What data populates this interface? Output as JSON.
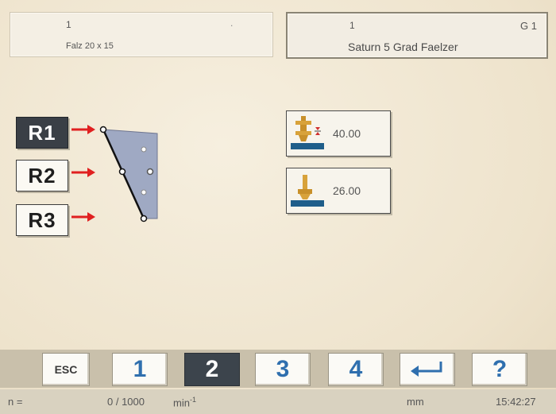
{
  "header": {
    "left": {
      "number": "1",
      "name": "Falz 20 x 15",
      "dot": "."
    },
    "right": {
      "number": "1",
      "group": "G 1",
      "name": "Saturn 5 Grad Faelzer"
    }
  },
  "rows": [
    {
      "label": "R1",
      "active": true
    },
    {
      "label": "R2",
      "active": false
    },
    {
      "label": "R3",
      "active": false
    }
  ],
  "values": [
    {
      "icon": "spindle-height-icon",
      "value": "40.00"
    },
    {
      "icon": "tool-length-icon",
      "value": "26.00"
    }
  ],
  "toolbar": {
    "esc": "ESC",
    "page1": "1",
    "page2": "2",
    "page3": "3",
    "page4": "4",
    "enter": "↵",
    "help": "?"
  },
  "status": {
    "n_label": "n =",
    "count": "0 / 1000",
    "unit_speed": "min",
    "unit_speed_exp": "-1",
    "unit_length": "mm",
    "time": "15:42:27"
  },
  "colors": {
    "arrow": "#e02020",
    "profile_fill": "#9fa9c3",
    "active_button": "#3a3f46",
    "digit_blue": "#2f6fae"
  }
}
